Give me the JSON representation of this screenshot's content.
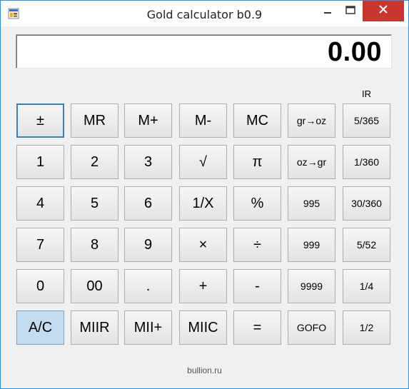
{
  "window": {
    "title": "Gold calculator b0.9",
    "icon": "app-icon",
    "controls": [
      "minimize-icon",
      "maximize-icon",
      "close-icon"
    ],
    "close_color": "#c7372f",
    "border_color": "#2b8fe0"
  },
  "display": {
    "value": "0.00"
  },
  "ir_label": "IR",
  "buttons": {
    "plusminus": "±",
    "mr": "MR",
    "mplus": "M+",
    "mminus": "M-",
    "mc": "MC",
    "gr_oz": "gr→oz",
    "r5_365": "5/365",
    "d1": "1",
    "d2": "2",
    "d3": "3",
    "sqrt": "√",
    "pi": "π",
    "oz_gr": "oz→gr",
    "r1_360": "1/360",
    "d4": "4",
    "d5": "5",
    "d6": "6",
    "recip": "1/X",
    "percent": "%",
    "f995": "995",
    "r30_360": "30/360",
    "d7": "7",
    "d8": "8",
    "d9": "9",
    "mult": "×",
    "div": "÷",
    "f999": "999",
    "r5_52": "5/52",
    "d0": "0",
    "d00": "00",
    "dot": ".",
    "plus": "+",
    "minus": "-",
    "f9999": "9999",
    "r1_4": "1/4",
    "ac": "A/C",
    "miir": "MIIR",
    "miiplus": "MII+",
    "miic": "MIIC",
    "equals": "=",
    "gofo": "GOFO",
    "r1_2": "1/2"
  },
  "footer": "bullion.ru"
}
